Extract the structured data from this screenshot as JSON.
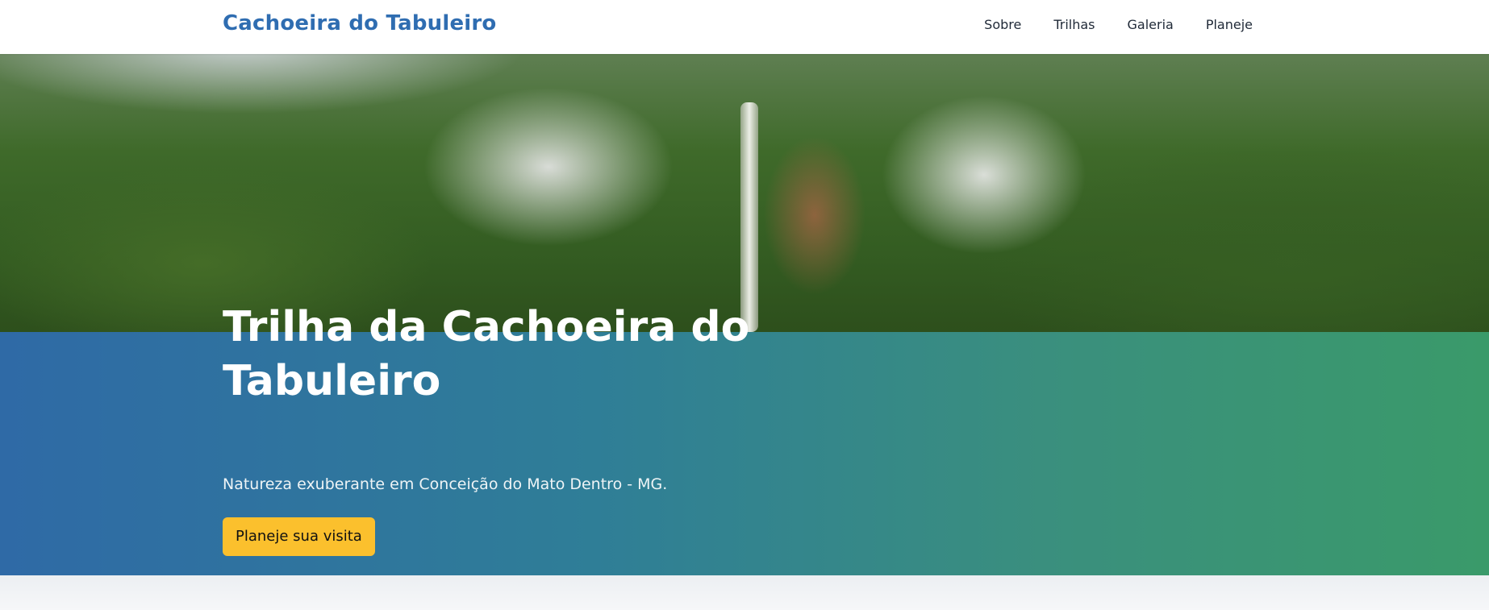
{
  "header": {
    "brand": "Cachoeira do Tabuleiro",
    "nav": [
      {
        "label": "Sobre"
      },
      {
        "label": "Trilhas"
      },
      {
        "label": "Galeria"
      },
      {
        "label": "Planeje"
      }
    ]
  },
  "hero": {
    "title": "Trilha da Cachoeira do Tabuleiro",
    "subtitle": "Natureza exuberante em Conceição do Mato Dentro - MG.",
    "cta_label": "Planeje sua visita"
  },
  "colors": {
    "brand": "#2f6db1",
    "cta": "#fbc02d",
    "band_start": "#2f6aa6",
    "band_end": "#3a9a6a"
  }
}
